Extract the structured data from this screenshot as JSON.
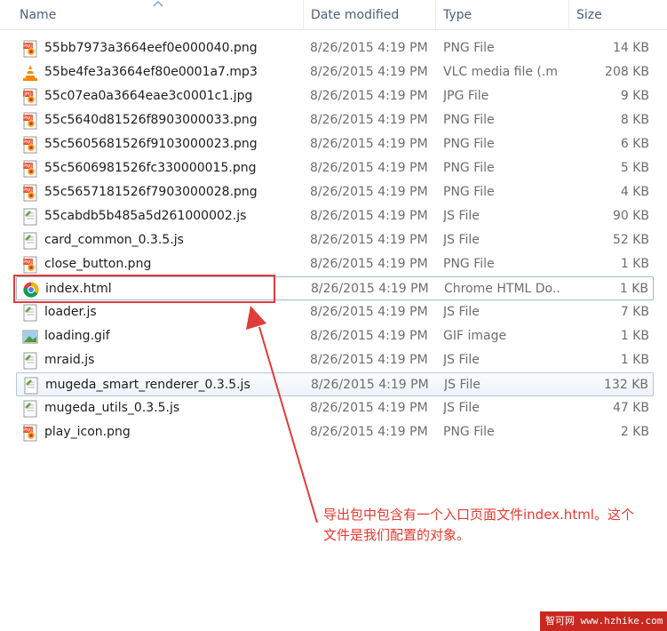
{
  "header": {
    "name": "Name",
    "date_modified": "Date modified",
    "type": "Type",
    "size": "Size"
  },
  "files": [
    {
      "name": "55bb7973a3664eef0e000040.png",
      "date": "8/26/2015 4:19 PM",
      "type": "PNG File",
      "size": "14 KB",
      "icon": "png-file-icon"
    },
    {
      "name": "55be4fe3a3664ef80e0001a7.mp3",
      "date": "8/26/2015 4:19 PM",
      "type": "VLC media file (.m...",
      "size": "208 KB",
      "icon": "vlc-cone-icon"
    },
    {
      "name": "55c07ea0a3664eae3c0001c1.jpg",
      "date": "8/26/2015 4:19 PM",
      "type": "JPG File",
      "size": "9 KB",
      "icon": "jpg-file-icon"
    },
    {
      "name": "55c5640d81526f8903000033.png",
      "date": "8/26/2015 4:19 PM",
      "type": "PNG File",
      "size": "8 KB",
      "icon": "png-file-icon"
    },
    {
      "name": "55c5605681526f9103000023.png",
      "date": "8/26/2015 4:19 PM",
      "type": "PNG File",
      "size": "6 KB",
      "icon": "png-file-icon"
    },
    {
      "name": "55c5606981526fc330000015.png",
      "date": "8/26/2015 4:19 PM",
      "type": "PNG File",
      "size": "5 KB",
      "icon": "png-file-icon"
    },
    {
      "name": "55c5657181526f7903000028.png",
      "date": "8/26/2015 4:19 PM",
      "type": "PNG File",
      "size": "4 KB",
      "icon": "png-file-icon"
    },
    {
      "name": "55cabdb5b485a5d261000002.js",
      "date": "8/26/2015 4:19 PM",
      "type": "JS File",
      "size": "90 KB",
      "icon": "js-file-icon"
    },
    {
      "name": "card_common_0.3.5.js",
      "date": "8/26/2015 4:19 PM",
      "type": "JS File",
      "size": "52 KB",
      "icon": "js-file-icon"
    },
    {
      "name": "close_button.png",
      "date": "8/26/2015 4:19 PM",
      "type": "PNG File",
      "size": "1 KB",
      "icon": "png-file-icon"
    },
    {
      "name": "index.html",
      "date": "8/26/2015 4:19 PM",
      "type": "Chrome HTML Do...",
      "size": "1 KB",
      "icon": "chrome-icon"
    },
    {
      "name": "loader.js",
      "date": "8/26/2015 4:19 PM",
      "type": "JS File",
      "size": "7 KB",
      "icon": "js-file-icon"
    },
    {
      "name": "loading.gif",
      "date": "8/26/2015 4:19 PM",
      "type": "GIF image",
      "size": "1 KB",
      "icon": "gif-image-icon"
    },
    {
      "name": "mraid.js",
      "date": "8/26/2015 4:19 PM",
      "type": "JS File",
      "size": "1 KB",
      "icon": "js-file-icon"
    },
    {
      "name": "mugeda_smart_renderer_0.3.5.js",
      "date": "8/26/2015 4:19 PM",
      "type": "JS File",
      "size": "132 KB",
      "icon": "js-file-icon"
    },
    {
      "name": "mugeda_utils_0.3.5.js",
      "date": "8/26/2015 4:19 PM",
      "type": "JS File",
      "size": "47 KB",
      "icon": "js-file-icon"
    },
    {
      "name": "play_icon.png",
      "date": "8/26/2015 4:19 PM",
      "type": "PNG File",
      "size": "2 KB",
      "icon": "png-file-icon"
    }
  ],
  "annotation": {
    "line1": "导出包中包含有一个入口页面文件index.html。这个",
    "line2": "文件是我们配置的对象。",
    "color": "#e8392f"
  },
  "watermark": "智可网 www.hzhike.com"
}
